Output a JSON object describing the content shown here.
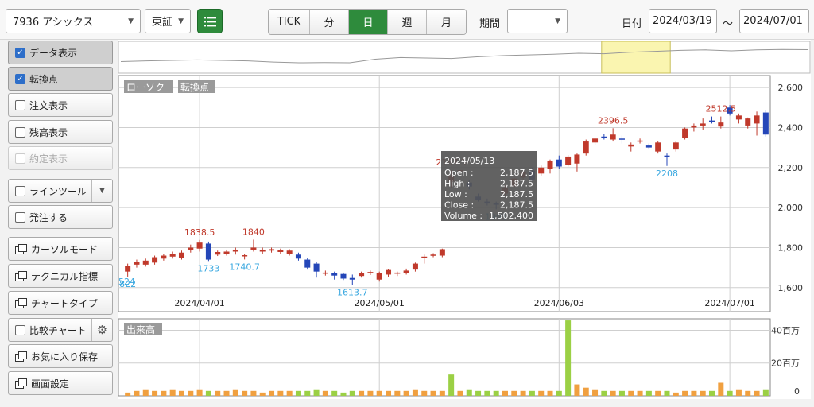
{
  "toolbar": {
    "symbol": "7936 アシックス",
    "market": "東証",
    "periods": [
      "TICK",
      "分",
      "日",
      "週",
      "月"
    ],
    "active_period": "日",
    "range_label": "期間",
    "range_value": "",
    "date_label": "日付",
    "date_from": "2024/03/19",
    "date_sep": "〜",
    "date_to": "2024/07/01"
  },
  "sidebar": {
    "data_display": "データ表示",
    "turning_points": "転換点",
    "order_display": "注文表示",
    "balance_display": "残高表示",
    "execution_display": "約定表示",
    "line_tool": "ラインツール",
    "place_order": "発注する",
    "cursor_mode": "カーソルモード",
    "technical": "テクニカル指標",
    "chart_type": "チャートタイプ",
    "compare_chart": "比較チャート",
    "save_favorite": "お気に入り保存",
    "screen_settings": "画面設定"
  },
  "chart_data": {
    "type": "candlestick",
    "badges": [
      "ローソク",
      "転換点"
    ],
    "volume_badge": "出来高",
    "price_ticks": [
      "2,600",
      "2,400",
      "2,200",
      "2,000",
      "1,800",
      "1,600"
    ],
    "price_tick_values": [
      2600,
      2400,
      2200,
      2000,
      1800,
      1600
    ],
    "ylim": [
      1480,
      2660
    ],
    "volume_ticks": [
      "40百万",
      "20百万",
      "0"
    ],
    "volume_tick_values": [
      40,
      20,
      0
    ],
    "volume_ylim": [
      0,
      47
    ],
    "x_labels": [
      {
        "label": "2024/04/01",
        "index": 8
      },
      {
        "label": "2024/05/01",
        "index": 28
      },
      {
        "label": "2024/06/03",
        "index": 48
      },
      {
        "label": "2024/07/01",
        "index": 67
      }
    ],
    "candles": [
      {
        "o": 1680,
        "h": 1720,
        "l": 1655,
        "c": 1710
      },
      {
        "o": 1715,
        "h": 1740,
        "l": 1700,
        "c": 1730
      },
      {
        "o": 1715,
        "h": 1745,
        "l": 1705,
        "c": 1735
      },
      {
        "o": 1725,
        "h": 1760,
        "l": 1715,
        "c": 1752
      },
      {
        "o": 1745,
        "h": 1770,
        "l": 1735,
        "c": 1760
      },
      {
        "o": 1755,
        "h": 1780,
        "l": 1745,
        "c": 1768
      },
      {
        "o": 1748,
        "h": 1785,
        "l": 1740,
        "c": 1775
      },
      {
        "o": 1790,
        "h": 1815,
        "l": 1775,
        "c": 1800
      },
      {
        "o": 1795,
        "h": 1838.5,
        "l": 1780,
        "c": 1825
      },
      {
        "o": 1820,
        "h": 1830,
        "l": 1733,
        "c": 1740
      },
      {
        "o": 1765,
        "h": 1785,
        "l": 1758,
        "c": 1778
      },
      {
        "o": 1770,
        "h": 1790,
        "l": 1760,
        "c": 1780
      },
      {
        "o": 1780,
        "h": 1800,
        "l": 1765,
        "c": 1790
      },
      {
        "o": 1758,
        "h": 1770,
        "l": 1740.7,
        "c": 1762
      },
      {
        "o": 1790,
        "h": 1840,
        "l": 1780,
        "c": 1800
      },
      {
        "o": 1780,
        "h": 1800,
        "l": 1770,
        "c": 1790
      },
      {
        "o": 1785,
        "h": 1800,
        "l": 1775,
        "c": 1792
      },
      {
        "o": 1778,
        "h": 1795,
        "l": 1768,
        "c": 1788
      },
      {
        "o": 1768,
        "h": 1792,
        "l": 1760,
        "c": 1785
      },
      {
        "o": 1765,
        "h": 1775,
        "l": 1735,
        "c": 1745
      },
      {
        "o": 1740,
        "h": 1748,
        "l": 1690,
        "c": 1700
      },
      {
        "o": 1720,
        "h": 1728,
        "l": 1650,
        "c": 1680
      },
      {
        "o": 1672,
        "h": 1685,
        "l": 1660,
        "c": 1675
      },
      {
        "o": 1672,
        "h": 1680,
        "l": 1640,
        "c": 1660
      },
      {
        "o": 1668,
        "h": 1675,
        "l": 1638,
        "c": 1645
      },
      {
        "o": 1648,
        "h": 1665,
        "l": 1613.7,
        "c": 1640
      },
      {
        "o": 1658,
        "h": 1680,
        "l": 1650,
        "c": 1674
      },
      {
        "o": 1672,
        "h": 1685,
        "l": 1663,
        "c": 1678
      },
      {
        "o": 1640,
        "h": 1680,
        "l": 1630,
        "c": 1672
      },
      {
        "o": 1665,
        "h": 1692,
        "l": 1655,
        "c": 1688
      },
      {
        "o": 1670,
        "h": 1680,
        "l": 1658,
        "c": 1675
      },
      {
        "o": 1672,
        "h": 1695,
        "l": 1665,
        "c": 1685
      },
      {
        "o": 1690,
        "h": 1725,
        "l": 1680,
        "c": 1720
      },
      {
        "o": 1750,
        "h": 1765,
        "l": 1720,
        "c": 1755
      },
      {
        "o": 1760,
        "h": 1772,
        "l": 1752,
        "c": 1765
      },
      {
        "o": 1760,
        "h": 1795,
        "l": 1752,
        "c": 1792
      },
      {
        "o": 2130,
        "h": 2187.5,
        "l": 2100,
        "c": 2160
      },
      {
        "o": 2187.5,
        "h": 2187.5,
        "l": 2187.5,
        "c": 2187.5
      },
      {
        "o": 2125,
        "h": 2140,
        "l": 2090,
        "c": 2105
      },
      {
        "o": 2055,
        "h": 2070,
        "l": 2030,
        "c": 2040
      },
      {
        "o": 2030,
        "h": 2045,
        "l": 2010,
        "c": 2020
      },
      {
        "o": 2020,
        "h": 2030,
        "l": 1991,
        "c": 2015
      },
      {
        "o": 2070,
        "h": 2110,
        "l": 2060,
        "c": 2100
      },
      {
        "o": 2105,
        "h": 2150,
        "l": 2095,
        "c": 2145
      },
      {
        "o": 2150,
        "h": 2185,
        "l": 2140,
        "c": 2175
      },
      {
        "o": 2185,
        "h": 2200,
        "l": 2130,
        "c": 2140
      },
      {
        "o": 2170,
        "h": 2210,
        "l": 2160,
        "c": 2200
      },
      {
        "o": 2195,
        "h": 2240,
        "l": 2170,
        "c": 2235
      },
      {
        "o": 2240,
        "h": 2260,
        "l": 2195,
        "c": 2205
      },
      {
        "o": 2215,
        "h": 2262,
        "l": 2205,
        "c": 2255
      },
      {
        "o": 2220,
        "h": 2270,
        "l": 2180,
        "c": 2265
      },
      {
        "o": 2270,
        "h": 2340,
        "l": 2260,
        "c": 2330
      },
      {
        "o": 2325,
        "h": 2350,
        "l": 2310,
        "c": 2345
      },
      {
        "o": 2355,
        "h": 2370,
        "l": 2340,
        "c": 2350
      },
      {
        "o": 2340,
        "h": 2396.5,
        "l": 2330,
        "c": 2365
      },
      {
        "o": 2345,
        "h": 2360,
        "l": 2320,
        "c": 2340
      },
      {
        "o": 2305,
        "h": 2325,
        "l": 2280,
        "c": 2315
      },
      {
        "o": 2330,
        "h": 2345,
        "l": 2320,
        "c": 2335
      },
      {
        "o": 2310,
        "h": 2320,
        "l": 2290,
        "c": 2300
      },
      {
        "o": 2280,
        "h": 2330,
        "l": 2270,
        "c": 2325
      },
      {
        "o": 2260,
        "h": 2270,
        "l": 2208,
        "c": 2255
      },
      {
        "o": 2290,
        "h": 2330,
        "l": 2280,
        "c": 2325
      },
      {
        "o": 2350,
        "h": 2400,
        "l": 2340,
        "c": 2395
      },
      {
        "o": 2400,
        "h": 2420,
        "l": 2380,
        "c": 2410
      },
      {
        "o": 2410,
        "h": 2445,
        "l": 2390,
        "c": 2420
      },
      {
        "o": 2435,
        "h": 2455,
        "l": 2420,
        "c": 2430
      },
      {
        "o": 2405,
        "h": 2455,
        "l": 2395,
        "c": 2425
      },
      {
        "o": 2500,
        "h": 2512.5,
        "l": 2460,
        "c": 2470
      },
      {
        "o": 2440,
        "h": 2470,
        "l": 2420,
        "c": 2460
      },
      {
        "o": 2410,
        "h": 2450,
        "l": 2395,
        "c": 2445
      },
      {
        "o": 2420,
        "h": 2480,
        "l": 2360,
        "c": 2460
      },
      {
        "o": 2475,
        "h": 2485,
        "l": 2355,
        "c": 2365
      }
    ],
    "volumes": [
      2,
      3,
      4,
      3,
      3,
      4,
      3,
      3,
      4,
      3,
      3,
      3,
      4,
      3,
      3,
      2,
      3,
      3,
      3,
      3,
      3,
      4,
      3,
      3,
      2,
      3,
      3,
      3,
      3,
      3,
      3,
      3,
      4,
      3,
      3,
      3,
      13,
      3,
      4,
      3,
      3,
      3,
      3,
      3,
      3,
      3,
      3,
      3,
      3,
      46,
      7,
      5,
      4,
      3,
      3,
      3,
      3,
      3,
      3,
      3,
      3,
      2,
      3,
      3,
      3,
      3,
      8,
      3,
      4,
      3,
      3,
      4
    ],
    "pivot_labels": [
      {
        "index": 0,
        "value": "822",
        "kind": "low"
      },
      {
        "index": 8,
        "value": "1838.5",
        "kind": "high"
      },
      {
        "index": 9,
        "value": "1733",
        "kind": "low"
      },
      {
        "index": 14,
        "value": "1840",
        "kind": "high"
      },
      {
        "index": 13,
        "value": "1740.7",
        "kind": "low"
      },
      {
        "index": 25,
        "value": "1613.7",
        "kind": "low"
      },
      {
        "index": 36,
        "value": "2187.5",
        "kind": "high"
      },
      {
        "index": 41,
        "value": "1991",
        "kind": "low"
      },
      {
        "index": 54,
        "value": "2396.5",
        "kind": "high"
      },
      {
        "index": 60,
        "value": "2208",
        "kind": "low"
      },
      {
        "index": 66,
        "value": "2512.5",
        "kind": "high"
      }
    ],
    "edge_label": "524",
    "navigator": {
      "values": [
        0.35,
        0.38,
        0.4,
        0.42,
        0.4,
        0.38,
        0.33,
        0.3,
        0.31,
        0.3,
        0.45,
        0.52,
        0.5,
        0.48,
        0.55,
        0.6,
        0.63,
        0.66,
        0.7,
        0.68,
        0.74,
        0.78,
        0.82,
        0.84,
        0.8,
        0.84,
        0.86,
        0.85
      ],
      "highlight_start": 0.7,
      "highlight_end": 0.8
    },
    "tooltip": {
      "date": "2024/05/13",
      "rows": [
        {
          "k": "Open :",
          "v": "2,187.5"
        },
        {
          "k": "High :",
          "v": "2,187.5"
        },
        {
          "k": "Low :",
          "v": "2,187.5"
        },
        {
          "k": "Close :",
          "v": "2,187.5"
        },
        {
          "k": "Volume :",
          "v": "1,502,400"
        }
      ]
    },
    "colors": {
      "up": "#c0392b",
      "down": "#2446b8",
      "vol_normal": "#f0a040",
      "vol_highlight": "#9bd045",
      "pivot_high": "#c0392b",
      "pivot_low": "#3aa8e0"
    }
  }
}
